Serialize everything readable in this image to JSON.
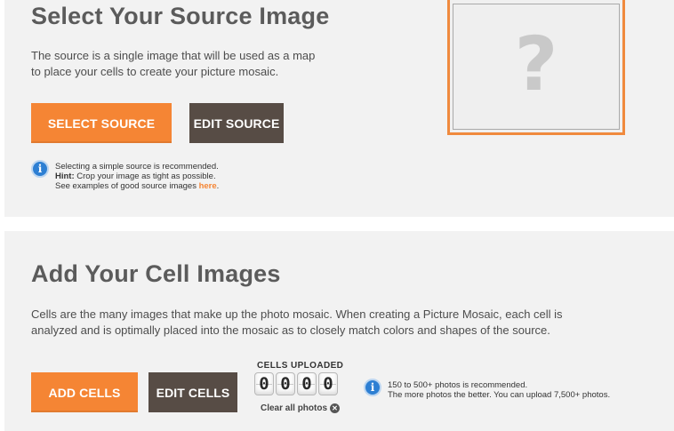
{
  "source": {
    "title": "Select Your Source Image",
    "description": "The source is a single image that will be used as a map to place your cells to create your picture mosaic.",
    "select_label": "SELECT SOURCE",
    "edit_label": "EDIT SOURCE",
    "note_line1": "Selecting a simple source is recommended.",
    "note_hint_label": "Hint:",
    "note_hint_text": " Crop your image as tight as possible.",
    "note_line3": "See examples of good source images ",
    "note_link": "here",
    "note_period": ".",
    "preview_placeholder": "?"
  },
  "cells": {
    "title": "Add Your Cell Images",
    "description": "Cells are the many images that make up the photo mosaic. When creating a Picture Mosaic, each cell is analyzed and is optimally placed into the mosaic as to closely match colors and shapes of the source.",
    "add_label": "ADD CELLS",
    "edit_label": "EDIT CELLS",
    "counter_label": "CELLS UPLOADED",
    "counter_digits": [
      "0",
      "0",
      "0",
      "0"
    ],
    "clear_label": "Clear all photos",
    "note_line1": "150 to 500+ photos is recommended.",
    "note_line2": "The more photos the better. You can upload 7,500+ photos."
  },
  "colors": {
    "accent": "#f58534",
    "dark_button": "#574c45",
    "info_blue": "#2d7fd3",
    "panel_bg": "#f2f2f2"
  },
  "icons": [
    "info-icon",
    "question-mark-placeholder",
    "clear-x-icon"
  ]
}
